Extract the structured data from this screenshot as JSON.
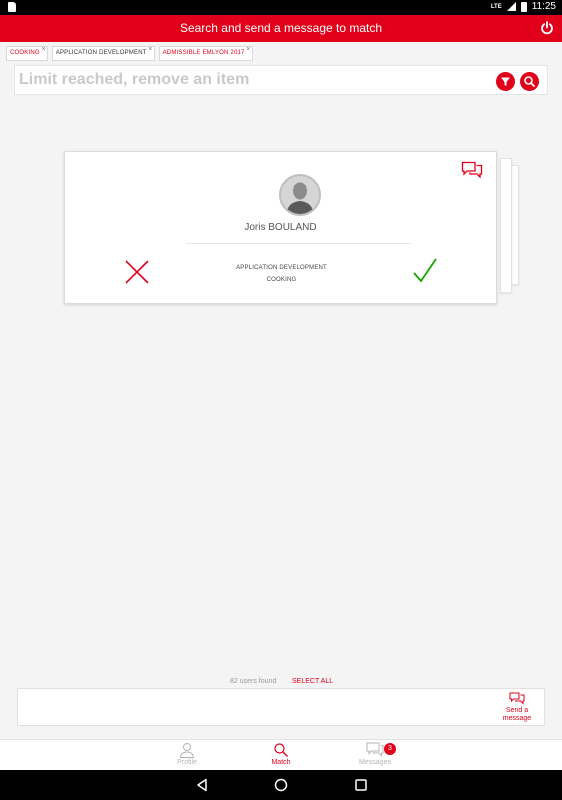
{
  "statusbar": {
    "network": "LTE",
    "time": "11:25"
  },
  "header": {
    "title": "Search and send a message to match"
  },
  "tags": [
    {
      "label": "COOKING"
    },
    {
      "label": "APPLICATION DEVELOPMENT"
    },
    {
      "label": "ADMISSIBLE EMLYON 2017"
    }
  ],
  "search": {
    "placeholder": "Limit reached, remove an item"
  },
  "card": {
    "name": "Joris BOULAND",
    "skills": [
      "APPLICATION DEVELOPMENT",
      "COOKING"
    ]
  },
  "results": {
    "count_text": "82 users found",
    "select_all": "SELECT ALL"
  },
  "send_message": {
    "line1": "Send a",
    "line2": "message"
  },
  "bottom_nav": {
    "profile": "Profile",
    "match": "Match",
    "messages": "Messages",
    "messages_badge": "3"
  },
  "colors": {
    "accent": "#e10019",
    "accept": "#1aa400",
    "background": "#f5f4f5"
  }
}
